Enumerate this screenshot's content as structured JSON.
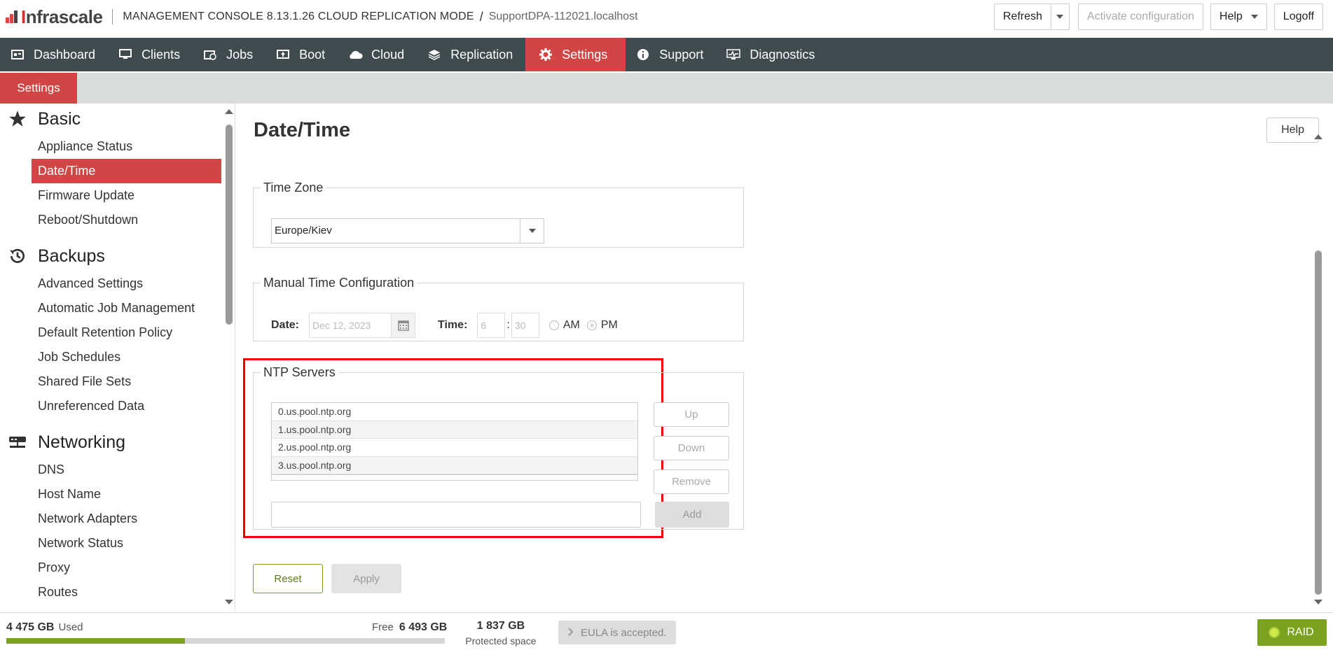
{
  "header": {
    "logo_text": "Infrascale",
    "console_title": "MANAGEMENT CONSOLE 8.13.1.26 CLOUD REPLICATION MODE",
    "separator": "/",
    "host": "SupportDPA-112021.localhost",
    "refresh_label": "Refresh",
    "activate_label": "Activate configuration",
    "help_label": "Help",
    "logoff_label": "Logoff"
  },
  "nav": {
    "items": [
      {
        "label": "Dashboard",
        "icon": "dashboard-icon"
      },
      {
        "label": "Clients",
        "icon": "monitor-icon"
      },
      {
        "label": "Jobs",
        "icon": "jobs-icon"
      },
      {
        "label": "Boot",
        "icon": "boot-icon"
      },
      {
        "label": "Cloud",
        "icon": "cloud-icon"
      },
      {
        "label": "Replication",
        "icon": "replication-icon"
      },
      {
        "label": "Settings",
        "icon": "gear-icon",
        "active": true
      },
      {
        "label": "Support",
        "icon": "info-icon"
      },
      {
        "label": "Diagnostics",
        "icon": "diagnostics-icon"
      }
    ]
  },
  "subtab": {
    "label": "Settings"
  },
  "sidebar": {
    "groups": [
      {
        "label": "Basic",
        "icon": "star-icon",
        "items": [
          "Appliance Status",
          "Date/Time",
          "Firmware Update",
          "Reboot/Shutdown"
        ]
      },
      {
        "label": "Backups",
        "icon": "history-icon",
        "items": [
          "Advanced Settings",
          "Automatic Job Management",
          "Default Retention Policy",
          "Job Schedules",
          "Shared File Sets",
          "Unreferenced Data"
        ]
      },
      {
        "label": "Networking",
        "icon": "network-icon",
        "items": [
          "DNS",
          "Host Name",
          "Network Adapters",
          "Network Status",
          "Proxy",
          "Routes"
        ]
      }
    ],
    "selected": "Date/Time"
  },
  "content": {
    "title": "Date/Time",
    "help_label": "Help",
    "timezone": {
      "legend": "Time Zone",
      "value": "Europe/Kiev"
    },
    "manual": {
      "legend": "Manual Time Configuration",
      "date_label": "Date:",
      "date_value": "Dec 12, 2023",
      "time_label": "Time:",
      "hour": "6",
      "colon": ":",
      "minute": "30",
      "am_label": "AM",
      "pm_label": "PM",
      "selected_period": "PM"
    },
    "ntp": {
      "legend": "NTP Servers",
      "servers": [
        "0.us.pool.ntp.org",
        "1.us.pool.ntp.org",
        "2.us.pool.ntp.org",
        "3.us.pool.ntp.org"
      ],
      "up_label": "Up",
      "down_label": "Down",
      "remove_label": "Remove",
      "add_label": "Add",
      "input_value": ""
    },
    "reset_label": "Reset",
    "apply_label": "Apply"
  },
  "footer": {
    "used_value": "4 475 GB",
    "used_label": "Used",
    "free_label": "Free",
    "free_value": "6 493 GB",
    "used_fraction": 0.408,
    "protected_value": "1 837 GB",
    "protected_label": "Protected space",
    "eula_label": "EULA is accepted.",
    "raid_label": "RAID"
  },
  "colors": {
    "accent": "#d14545",
    "nav_bg": "#3f4b4f",
    "ok_green": "#7aa21e",
    "highlight": "#ee0000"
  }
}
